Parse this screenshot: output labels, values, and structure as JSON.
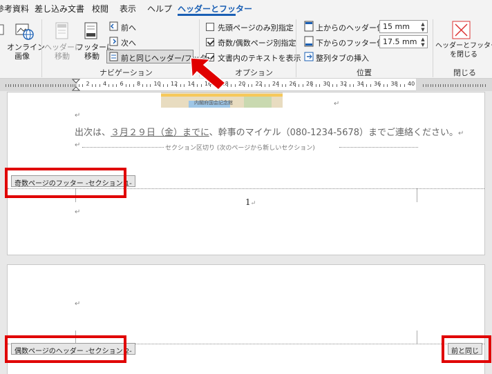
{
  "tabs": [
    {
      "label": "参考資料"
    },
    {
      "label": "差し込み文書"
    },
    {
      "label": "校閲"
    },
    {
      "label": "表示"
    },
    {
      "label": "ヘルプ"
    },
    {
      "label": "ヘッダーとフッター"
    }
  ],
  "ribbon": {
    "online_image": "オンライン\n画像",
    "goto_header": "ヘッダーに\n移動",
    "goto_footer": "フッターに\n移動",
    "prev": "前へ",
    "next": "次へ",
    "link_prev": "前と同じヘッダー/フッター",
    "nav_group": "ナビゲーション",
    "opt_first": "先頭ページのみ別指定",
    "opt_oddeven": "奇数/偶数ページ別指定",
    "opt_showtext": "文書内のテキストを表示",
    "opt_group": "オプション",
    "header_pos_label": "上からのヘッダー位置:",
    "header_pos_value": "15 mm",
    "footer_pos_label": "下からのフッター位置:",
    "footer_pos_value": "17.5 mm",
    "align_tab": "整列タブの挿入",
    "pos_group": "位置",
    "close_label": "ヘッダーとフッター\nを閉じる",
    "close_group": "閉じる"
  },
  "ruler": {
    "numbers": [
      "2",
      "4",
      "6",
      "8",
      "10",
      "12",
      "14",
      "16",
      "18",
      "20",
      "22",
      "24",
      "26",
      "28",
      "30",
      "32",
      "34",
      "36",
      "38",
      "40"
    ]
  },
  "document": {
    "map_label": "内閣府国会記念館",
    "sentence_pre": "出次は、",
    "sentence_date": "３月２９日（金）までに",
    "sentence_post": "、幹事のマイケル（080-1234-5678）までご連絡ください。",
    "section_break": "セクション区切り (次のページから新しいセクション)",
    "odd_footer_tag": "奇数ページのフッター -セクション 1-",
    "page_number": "1",
    "even_header_tag": "偶数ページのヘッダー -セクション 2-",
    "same_as_prev_tag": "前と同じ"
  },
  "colors": {
    "accent": "#1a5fb4",
    "highlight": "#e00000",
    "arrow": "#e00000"
  }
}
